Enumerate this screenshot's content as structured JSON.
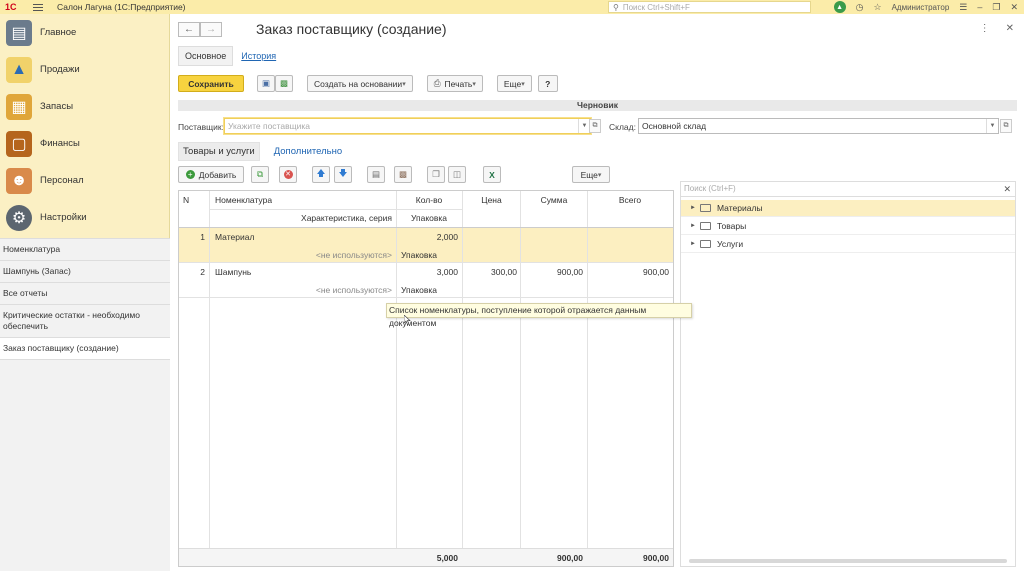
{
  "app": {
    "logo": "1С",
    "title": "Салон Лагуна  (1С:Предприятие)",
    "search_placeholder": "Поиск Ctrl+Shift+F",
    "user": "Администратор"
  },
  "sections": [
    {
      "label": "Главное",
      "icon": "home-icon"
    },
    {
      "label": "Продажи",
      "icon": "sales-icon"
    },
    {
      "label": "Запасы",
      "icon": "stock-icon"
    },
    {
      "label": "Финансы",
      "icon": "finance-icon"
    },
    {
      "label": "Персонал",
      "icon": "staff-icon"
    },
    {
      "label": "Настройки",
      "icon": "settings-icon"
    }
  ],
  "opened": [
    {
      "label": "Номенклатура"
    },
    {
      "label": "Шампунь (Запас)"
    },
    {
      "label": "Все отчеты"
    },
    {
      "label": "Критические остатки - необходимо обеспечить"
    },
    {
      "label": "Заказ поставщику (создание)"
    }
  ],
  "form": {
    "title": "Заказ поставщику (создание)",
    "tab_main": "Основное",
    "tab_history": "История",
    "save": "Сохранить",
    "create_based": "Создать на основании",
    "print": "Печать",
    "more": "Еще",
    "help": "?",
    "status": "Черновик",
    "supplier_label": "Поставщик:",
    "supplier_placeholder": "Укажите поставщика",
    "warehouse_label": "Склад:",
    "warehouse_value": "Основной склад"
  },
  "subtabs": {
    "goods": "Товары и услуги",
    "extra": "Дополнительно"
  },
  "table_toolbar": {
    "add": "Добавить",
    "more": "Еще"
  },
  "table": {
    "headers": {
      "n": "N",
      "item": "Номенклатура",
      "char": "Характеристика, серия",
      "qty": "Кол-во",
      "pack": "Упаковка",
      "price": "Цена",
      "sum": "Сумма",
      "total": "Всего"
    },
    "rows": [
      {
        "n": "1",
        "item": "Материал",
        "char": "<не используются>",
        "qty": "2,000",
        "pack": "Упаковка",
        "price": "",
        "sum": "",
        "total": ""
      },
      {
        "n": "2",
        "item": "Шампунь",
        "char": "<не используются>",
        "qty": "3,000",
        "pack": "Упаковка",
        "price": "300,00",
        "sum": "900,00",
        "total": "900,00"
      }
    ],
    "footer": {
      "qty": "5,000",
      "sum": "900,00",
      "total": "900,00"
    }
  },
  "tooltip": "Список номенклатуры, поступление которой отражается данным документом",
  "tree": {
    "search_placeholder": "Поиск (Ctrl+F)",
    "items": [
      {
        "label": "Материалы"
      },
      {
        "label": "Товары"
      },
      {
        "label": "Услуги"
      }
    ]
  }
}
